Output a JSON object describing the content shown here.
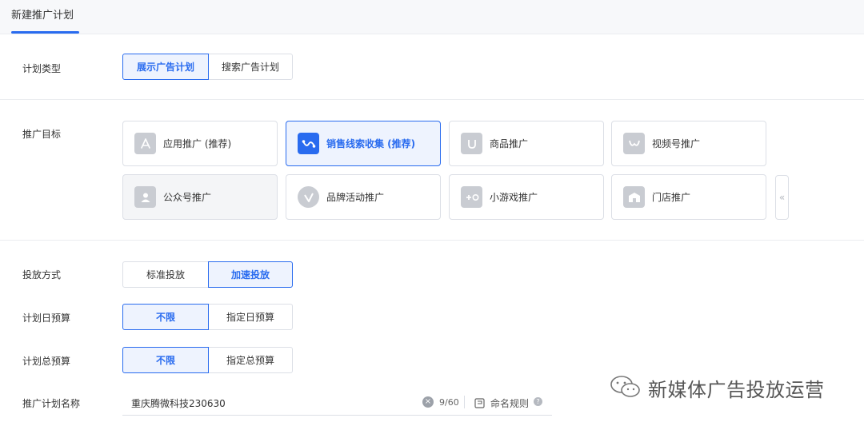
{
  "tabs": [
    {
      "label": "新建推广计划"
    }
  ],
  "plan_type": {
    "label": "计划类型",
    "options": [
      "展示广告计划",
      "搜索广告计划"
    ],
    "selected": "展示广告计划"
  },
  "promo_target": {
    "label": "推广目标",
    "cards": [
      {
        "label": "应用推广 (推荐)",
        "icon": "app-store-icon"
      },
      {
        "label": "销售线索收集 (推荐)",
        "icon": "lead-collect-icon"
      },
      {
        "label": "商品推广",
        "icon": "shopping-bag-icon"
      },
      {
        "label": "视频号推广",
        "icon": "channels-icon"
      },
      {
        "label": "公众号推广",
        "icon": "official-account-icon"
      },
      {
        "label": "品牌活动推广",
        "icon": "brand-v-icon"
      },
      {
        "label": "小游戏推广",
        "icon": "mini-game-icon"
      },
      {
        "label": "门店推广",
        "icon": "store-icon"
      }
    ],
    "selected": "销售线索收集 (推荐)",
    "collapse_glyph": "«"
  },
  "delivery_mode": {
    "label": "投放方式",
    "options": [
      "标准投放",
      "加速投放"
    ],
    "selected": "加速投放"
  },
  "daily_budget": {
    "label": "计划日预算",
    "options": [
      "不限",
      "指定日预算"
    ],
    "selected": "不限"
  },
  "total_budget": {
    "label": "计划总预算",
    "options": [
      "不限",
      "指定总预算"
    ],
    "selected": "不限"
  },
  "plan_name": {
    "label": "推广计划名称",
    "value": "重庆腾微科技230630",
    "count": "9/60",
    "rule_label": "命名规则"
  },
  "watermark": {
    "text": "新媒体广告投放运营"
  },
  "colors": {
    "accent": "#296bef",
    "border": "#dcdfe6",
    "icon_grey": "#c9ccd2"
  }
}
